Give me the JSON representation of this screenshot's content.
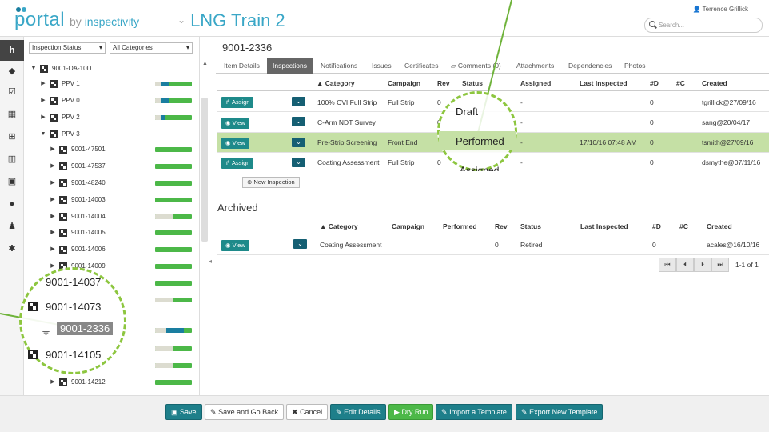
{
  "header": {
    "logo_text": "portal",
    "logo_by": "by",
    "logo_brand": "inspectivity",
    "title": "LNG Train 2",
    "user": "Terrence Grillick",
    "search_placeholder": "Search..."
  },
  "rail": {
    "active_letter": "h"
  },
  "tree": {
    "filter_status": "Inspection Status",
    "filter_category": "All Categories",
    "nodes": [
      {
        "label": "9001-OA-10D",
        "arrow": "▼"
      },
      {
        "label": "PPV 1",
        "arrow": "▶"
      },
      {
        "label": "PPV 0",
        "arrow": "▶"
      },
      {
        "label": "PPV 2",
        "arrow": "▶"
      },
      {
        "label": "PPV 3",
        "arrow": "▼"
      },
      {
        "label": "9001-47501",
        "arrow": "▶"
      },
      {
        "label": "9001-47537",
        "arrow": "▶"
      },
      {
        "label": "9001-48240",
        "arrow": "▶"
      },
      {
        "label": "9001-14003",
        "arrow": "▶"
      },
      {
        "label": "9001-14004",
        "arrow": "▶"
      },
      {
        "label": "9001-14005",
        "arrow": "▶"
      },
      {
        "label": "9001-14006",
        "arrow": "▶"
      },
      {
        "label": "9001-14009",
        "arrow": "▶"
      },
      {
        "label": "9001-14212",
        "arrow": "▶"
      }
    ],
    "zoom": {
      "node1": "9001-14037",
      "node2": "9001-14073",
      "node3": "9001-2336",
      "node4": "9001-14105"
    }
  },
  "main": {
    "record_title": "9001-2336",
    "tabs": [
      "Item Details",
      "Inspections",
      "Notifications",
      "Issues",
      "Certificates",
      "Comments (0)",
      "Attachments",
      "Dependencies",
      "Photos"
    ],
    "inspections": {
      "headers": [
        "▲ Category",
        "Campaign",
        "Rev",
        "Status",
        "Assigned",
        "Last Inspected",
        "#D",
        "#C",
        "Created"
      ],
      "rows": [
        {
          "action": "Assign",
          "category": "100% CVI Full Strip",
          "campaign": "Full Strip",
          "rev": "0",
          "status": "",
          "assigned": "-",
          "last": "",
          "d": "0",
          "c": "",
          "created": "tgrillick@27/09/16"
        },
        {
          "action": "View",
          "category": "C-Arm NDT Survey",
          "campaign": "",
          "rev": "0",
          "status": "",
          "assigned": "-",
          "last": "",
          "d": "0",
          "c": "",
          "created": "sang@20/04/17"
        },
        {
          "action": "View",
          "category": "Pre-Strip Screening",
          "campaign": "Front End",
          "rev": "0",
          "status": "",
          "assigned": "-",
          "last": "17/10/16 07:48 AM",
          "d": "0",
          "c": "",
          "created": "tsmith@27/09/16"
        },
        {
          "action": "Assign",
          "category": "Coating Assessment",
          "campaign": "Full Strip",
          "rev": "0",
          "status": "",
          "assigned": "-",
          "last": "",
          "d": "0",
          "c": "",
          "created": "dsmythe@07/11/16"
        }
      ],
      "new_button": "New Inspection",
      "status_zoom": [
        "Draft",
        "Performed",
        "Assigned"
      ]
    },
    "archived": {
      "heading": "Archived",
      "headers": [
        "▲ Category",
        "Campaign",
        "Performed",
        "Rev",
        "Status",
        "Last Inspected",
        "#D",
        "#C",
        "Created"
      ],
      "rows": [
        {
          "action": "View",
          "category": "Coating Assessment",
          "campaign": "",
          "performed": "",
          "rev": "0",
          "status": "Retired",
          "last": "",
          "d": "0",
          "c": "",
          "created": "acales@16/10/16"
        }
      ],
      "pager_text": "1-1 of 1"
    }
  },
  "footer": {
    "save": "Save",
    "save_back": "Save and Go Back",
    "cancel": "Cancel",
    "edit_details": "Edit Details",
    "dry_run": "Dry Run",
    "import_template": "Import a Template",
    "export_template": "Export New Template"
  },
  "colors": {
    "brand": "#3aa7c7",
    "teal_button": "#1e8a8a",
    "highlight_row": "#c5e0a5",
    "callout": "#8dc63f"
  }
}
